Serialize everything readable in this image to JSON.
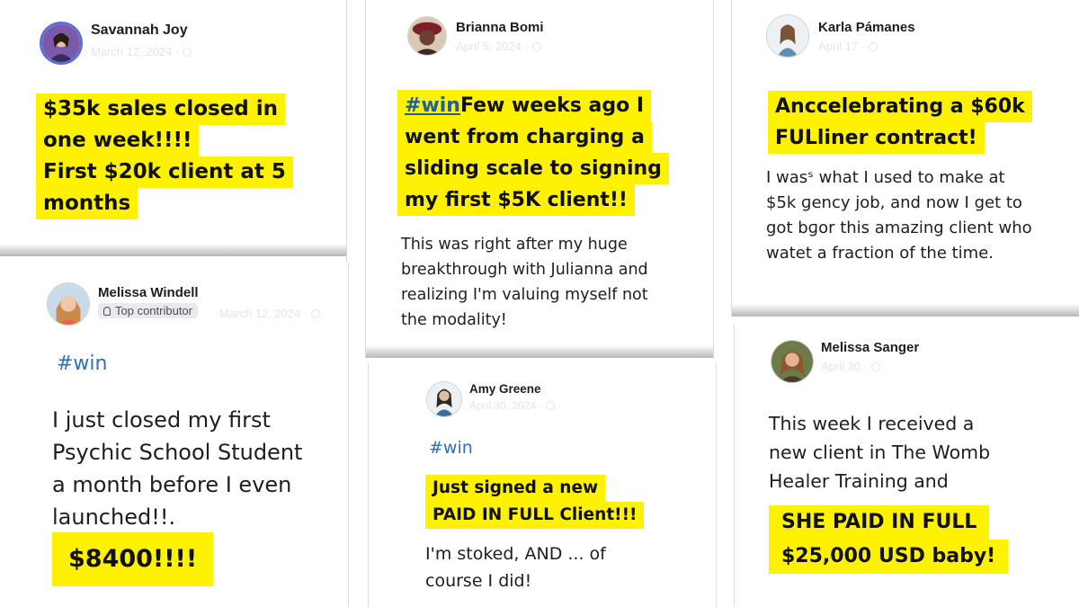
{
  "posts": {
    "savannah": {
      "author": "Savannah Joy",
      "date": "March 12, 2024 ·",
      "highlight": [
        "$35k sales closed in",
        "one week!!!!",
        "First $20k client at 5",
        "months"
      ]
    },
    "brianna": {
      "author": "Brianna Bomi",
      "date": "April 5, 2024 ·",
      "hashtag": "#win",
      "highlight_first_rest": " Few weeks ago I",
      "highlight": [
        "went from charging a",
        "sliding scale to signing",
        "my first $5K  client!!"
      ],
      "body": [
        "This was right after my huge",
        "breakthrough with Julianna and",
        "realizing I'm valuing myself not",
        "the modality!"
      ]
    },
    "karla": {
      "author": "Karla Pámanes",
      "date": "April 17 ·",
      "highlight": [
        "Anccelebrating a $60k",
        "FULliner contract!"
      ],
      "body": [
        "I wasˢ what I used to make at",
        "$5k ɡency job, and now I get to",
        "got bɡor this amazing client who",
        "watet a fraction of the time."
      ]
    },
    "melissa_w": {
      "author": "Melissa Windell",
      "badge": "Top contributor",
      "date": "March 12, 2024 ·",
      "hashtag": "#win",
      "body": [
        "I just closed my first",
        "Psychic School Student",
        "a month before I even",
        "launched!!."
      ],
      "highlight": [
        "$8400!!!!"
      ]
    },
    "amy": {
      "author": "Amy Greene",
      "date": "April 30, 2024 ·",
      "hashtag": "#win",
      "highlight": [
        "Just signed a new",
        "PAID IN FULL Client!!!"
      ],
      "body": [
        "I'm stoked, AND ... of",
        "course I did!"
      ]
    },
    "melissa_s": {
      "author": "Melissa Sanger",
      "date": "April 30 ·",
      "body": [
        "This week I received a",
        "new client in The Womb",
        "Healer Training and"
      ],
      "highlight": [
        "SHE PAID IN FULL",
        "$25,000 USD baby!"
      ]
    }
  },
  "colors": {
    "highlight": "#fff200",
    "hashtag": "#2f6fb8",
    "text": "#1c1e21"
  }
}
